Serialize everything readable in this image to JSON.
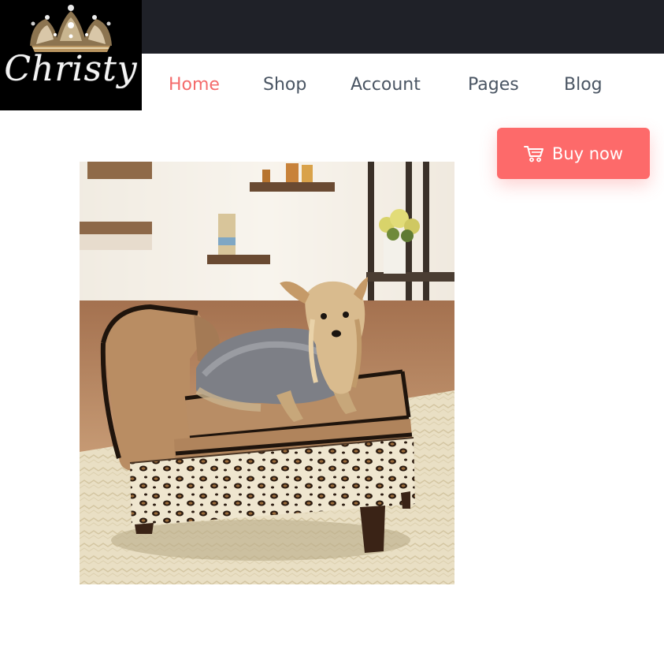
{
  "brand": {
    "logo_text": "Christy",
    "logo_icon": "crown-icon"
  },
  "nav": {
    "items": [
      {
        "label": "Home",
        "active": true
      },
      {
        "label": "Shop",
        "active": false
      },
      {
        "label": "Account",
        "active": false
      },
      {
        "label": "Pages",
        "active": false
      },
      {
        "label": "Blog",
        "active": false
      }
    ],
    "active_color": "#f46b6b",
    "text_color": "#4a5563"
  },
  "cta": {
    "label": "Buy now",
    "icon": "cart-icon",
    "color": "#fd6a6a"
  },
  "product_image": {
    "alt": "Small dog lying on a tan chaise pet bed with leopard-print storage base"
  },
  "colors": {
    "topbar": "#1f2128",
    "background": "#ffffff"
  }
}
